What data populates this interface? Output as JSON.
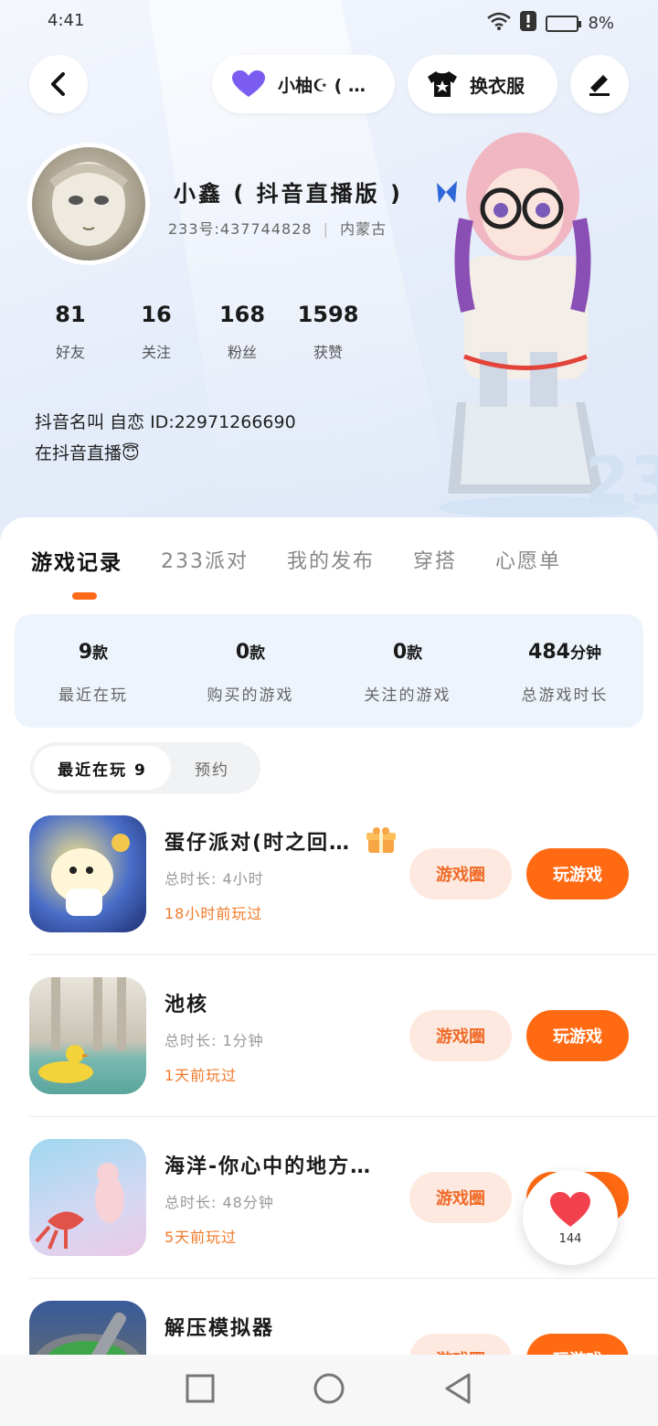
{
  "status": {
    "time": "4:41",
    "battery": "8%"
  },
  "nav": {
    "partner_label": "小柚☪︎ ( …",
    "outfit_label": "换衣服"
  },
  "profile": {
    "nickname": "小鑫 ( 抖音直播版 )",
    "uid": "233号:437744828",
    "region": "内蒙古",
    "stats": [
      {
        "value": "81",
        "label": "好友"
      },
      {
        "value": "16",
        "label": "关注"
      },
      {
        "value": "168",
        "label": "粉丝"
      },
      {
        "value": "1598",
        "label": "获赞"
      }
    ],
    "bio_line1": "抖音名叫 自恋 ID:22971266690",
    "bio_line2": "在抖音直播😇"
  },
  "tabs": [
    "游戏记录",
    "233派对",
    "我的发布",
    "穿搭",
    "心愿单"
  ],
  "summary": [
    {
      "num": "9",
      "unit": "款",
      "label": "最近在玩"
    },
    {
      "num": "0",
      "unit": "款",
      "label": "购买的游戏"
    },
    {
      "num": "0",
      "unit": "款",
      "label": "关注的游戏"
    },
    {
      "num": "484",
      "unit": "分钟",
      "label": "总游戏时长"
    }
  ],
  "segment": {
    "recent": "最近在玩 9",
    "reserve": "预约"
  },
  "games": [
    {
      "title": "蛋仔派对(时之回…",
      "duration": "总时长: 4小时",
      "last_played": "18小时前玩过",
      "circle": "游戏圈",
      "play": "玩游戏"
    },
    {
      "title": "池核",
      "duration": "总时长: 1分钟",
      "last_played": "1天前玩过",
      "circle": "游戏圈",
      "play": "玩游戏"
    },
    {
      "title": "海洋-你心中的地方…",
      "duration": "总时长: 48分钟",
      "last_played": "5天前玩过",
      "circle": "游戏圈",
      "play": "玩游戏"
    },
    {
      "title": "解压模拟器",
      "duration": "",
      "last_played": "",
      "circle": "游戏圈",
      "play": "玩游戏"
    }
  ],
  "like_count": "144",
  "colors": {
    "accent": "#ff6a12",
    "accent_light": "#fde9df",
    "tab_indicator": "#ff6a1a"
  }
}
